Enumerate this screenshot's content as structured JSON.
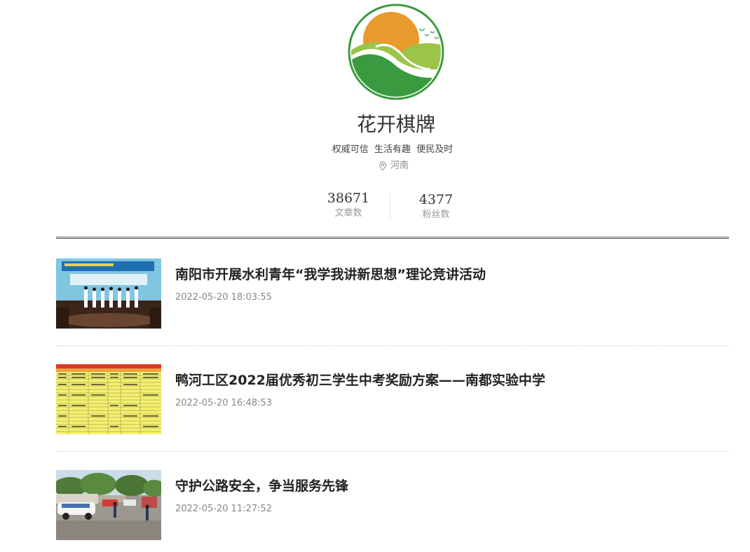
{
  "account": {
    "name": "花开棋牌",
    "slogan": "权威可信  生活有趣  便民及时",
    "location": "河南",
    "logo_icon": "sunrise-hills-logo",
    "colors": {
      "logo_green": "#3a9a3f",
      "logo_orange": "#e89a2c",
      "logo_light_green": "#9cc44a"
    }
  },
  "stats": [
    {
      "value": "38671",
      "label": "文章数"
    },
    {
      "value": "4377",
      "label": "粉丝数"
    }
  ],
  "articles": [
    {
      "title": "南阳市开展水利青年“我学我讲新思想”理论竞讲活动",
      "time": "2022-05-20 18:03:55",
      "thumb_icon": "stage-event-photo"
    },
    {
      "title": "鸭河工区2022届优秀初三学生中考奖励方案——南都实验中学",
      "time": "2022-05-20 16:48:53",
      "thumb_icon": "spreadsheet-photo"
    },
    {
      "title": "守护公路安全，争当服务先锋",
      "time": "2022-05-20 11:27:52",
      "thumb_icon": "road-checkpoint-photo"
    }
  ]
}
